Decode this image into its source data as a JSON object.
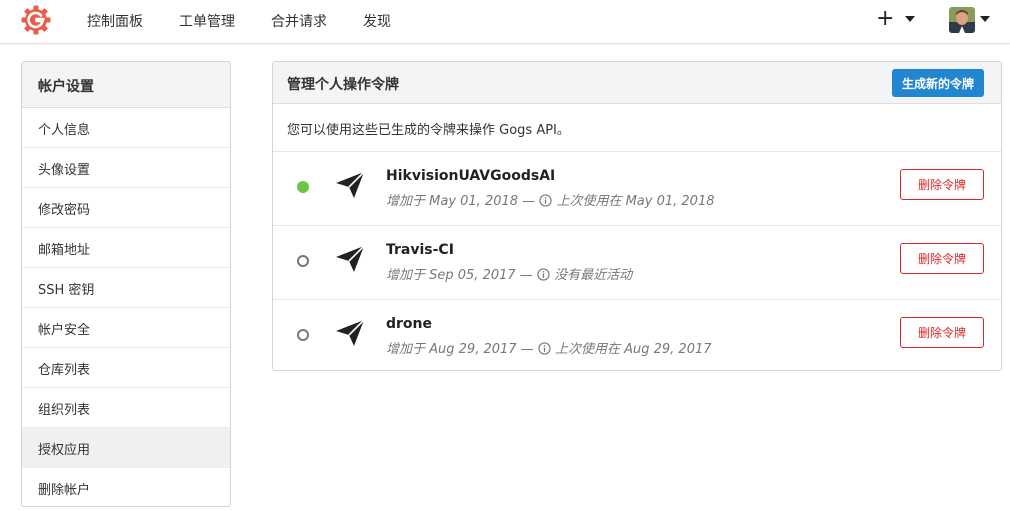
{
  "nav": {
    "items": [
      {
        "label": "控制面板"
      },
      {
        "label": "工单管理"
      },
      {
        "label": "合并请求"
      },
      {
        "label": "发现"
      }
    ],
    "plus_label": "+"
  },
  "sidebar": {
    "header": "帐户设置",
    "items": [
      {
        "label": "个人信息"
      },
      {
        "label": "头像设置"
      },
      {
        "label": "修改密码"
      },
      {
        "label": "邮箱地址"
      },
      {
        "label": "SSH 密钥"
      },
      {
        "label": "帐户安全"
      },
      {
        "label": "仓库列表"
      },
      {
        "label": "组织列表"
      },
      {
        "label": "授权应用",
        "active": true
      },
      {
        "label": "删除帐户"
      }
    ]
  },
  "main": {
    "title": "管理个人操作令牌",
    "generate_button": "生成新的令牌",
    "description": "您可以使用这些已生成的令牌来操作 Gogs API。",
    "tokens": [
      {
        "name": "HikvisionUAVGoodsAI",
        "added": "增加于 May 01, 2018 —",
        "last_used": "上次使用在 May 01, 2018",
        "status": "active",
        "delete_label": "删除令牌"
      },
      {
        "name": "Travis-CI",
        "added": "增加于 Sep 05, 2017 —",
        "last_used": "没有最近活动",
        "status": "inactive",
        "delete_label": "删除令牌"
      },
      {
        "name": "drone",
        "added": "增加于 Aug 29, 2017 —",
        "last_used": "上次使用在 Aug 29, 2017",
        "status": "inactive",
        "delete_label": "删除令牌"
      }
    ]
  },
  "colors": {
    "accent": "#2185d0",
    "danger": "#db2828",
    "active_dot": "#6cc644",
    "logo": "#e95d4a"
  },
  "icons": {
    "logo": "gogs-logo-icon",
    "token": "paper-plane-icon",
    "info": "info-circle-icon",
    "caret": "caret-down-icon"
  }
}
